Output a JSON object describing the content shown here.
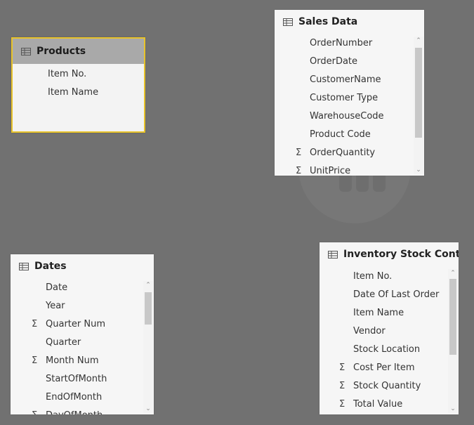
{
  "tables": {
    "products": {
      "title": "Products",
      "fields": [
        {
          "name": "Item No.",
          "sigma": false
        },
        {
          "name": "Item Name",
          "sigma": false
        }
      ]
    },
    "sales": {
      "title": "Sales Data",
      "fields": [
        {
          "name": "OrderNumber",
          "sigma": false
        },
        {
          "name": "OrderDate",
          "sigma": false
        },
        {
          "name": "CustomerName",
          "sigma": false
        },
        {
          "name": "Customer Type",
          "sigma": false
        },
        {
          "name": "WarehouseCode",
          "sigma": false
        },
        {
          "name": "Product Code",
          "sigma": false
        },
        {
          "name": "OrderQuantity",
          "sigma": true
        },
        {
          "name": "UnitPrice",
          "sigma": true
        }
      ]
    },
    "dates": {
      "title": "Dates",
      "fields": [
        {
          "name": "Date",
          "sigma": false
        },
        {
          "name": "Year",
          "sigma": false
        },
        {
          "name": "Quarter Num",
          "sigma": true
        },
        {
          "name": "Quarter",
          "sigma": false
        },
        {
          "name": "Month Num",
          "sigma": true
        },
        {
          "name": "StartOfMonth",
          "sigma": false
        },
        {
          "name": "EndOfMonth",
          "sigma": false
        },
        {
          "name": "DayOfMonth",
          "sigma": true
        }
      ]
    },
    "inventory": {
      "title": "Inventory Stock Control",
      "fields": [
        {
          "name": "Item No.",
          "sigma": false
        },
        {
          "name": "Date Of Last Order",
          "sigma": false
        },
        {
          "name": "Item Name",
          "sigma": false
        },
        {
          "name": "Vendor",
          "sigma": false
        },
        {
          "name": "Stock Location",
          "sigma": false
        },
        {
          "name": "Cost Per Item",
          "sigma": true
        },
        {
          "name": "Stock Quantity",
          "sigma": true
        },
        {
          "name": "Total Value",
          "sigma": true
        }
      ]
    }
  },
  "icons": {
    "table": "table-icon",
    "sum": "sigma-icon",
    "scroll_up": "chevron-up-icon",
    "scroll_down": "chevron-down-icon"
  },
  "colors": {
    "canvas": "#717171",
    "selected_border": "#e8c32a",
    "selected_header": "#a9a9a9",
    "card": "#f6f6f6"
  }
}
